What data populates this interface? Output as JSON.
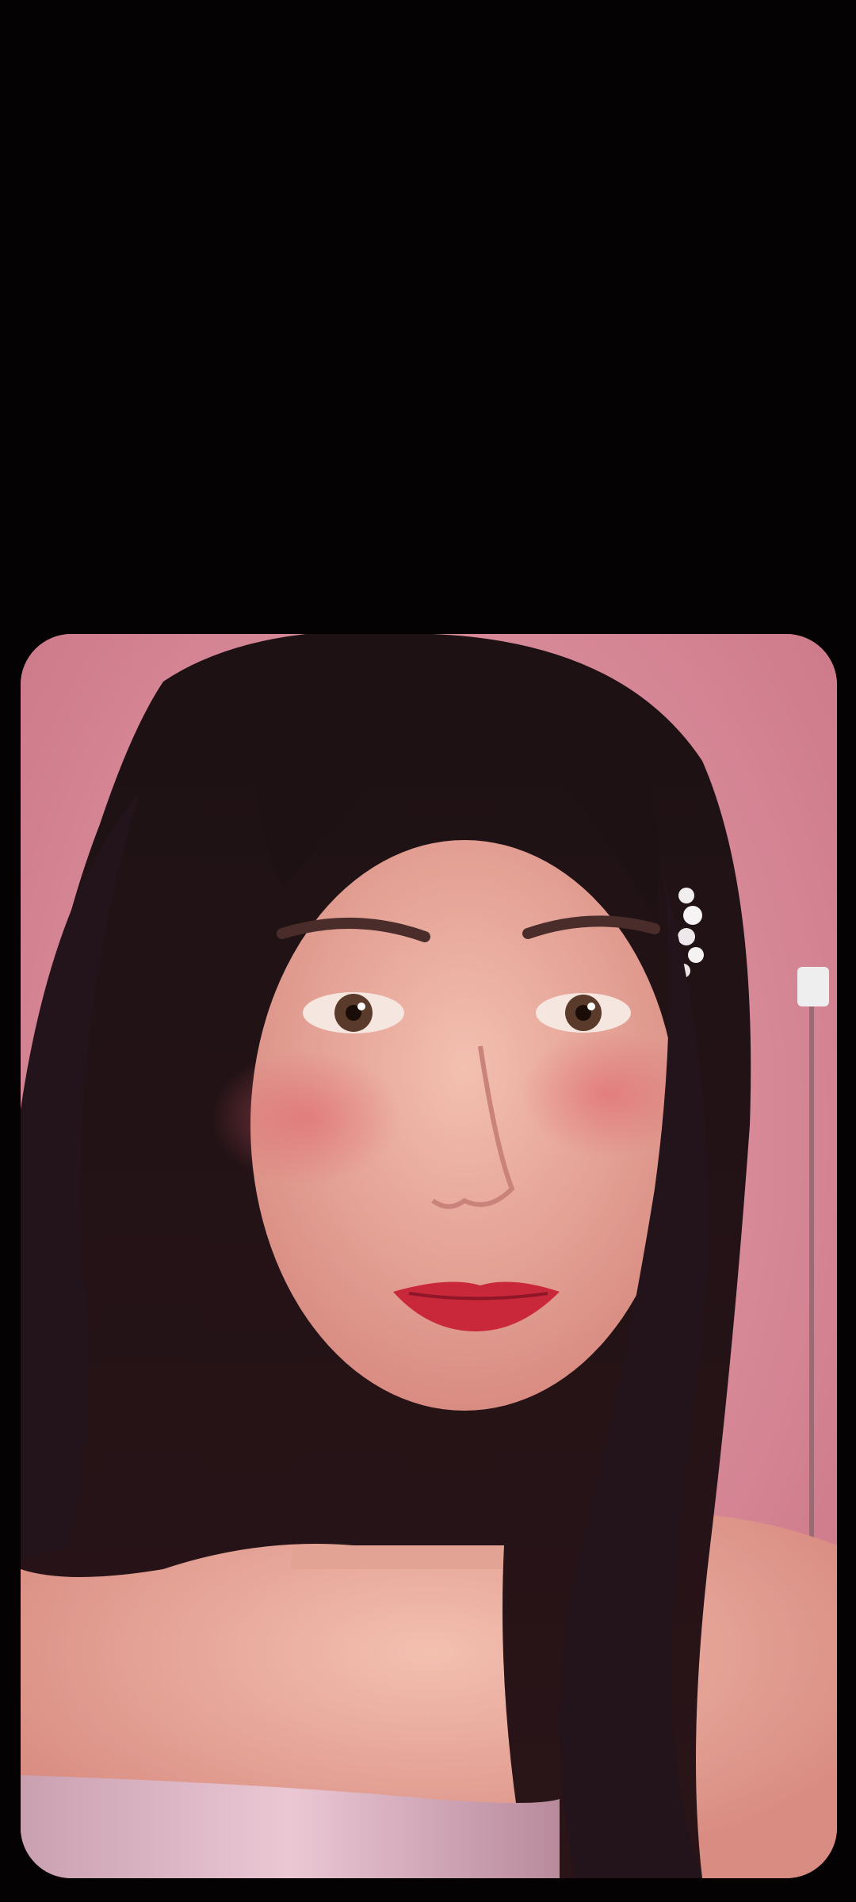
{
  "screen": {
    "background_color": "#050204"
  },
  "photo": {
    "subject": "selfie-portrait",
    "background_color": "#d98a98",
    "hair_color": "#1a0f12",
    "skin_color": "#e9a899",
    "lip_color": "#c8283a",
    "top_color": "#d6a6b8"
  }
}
